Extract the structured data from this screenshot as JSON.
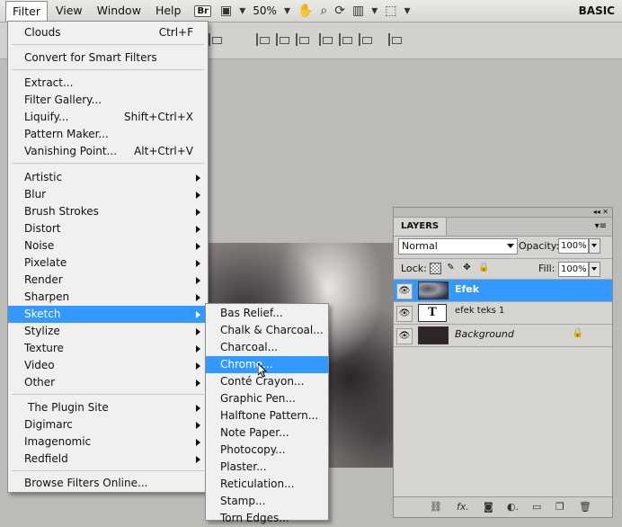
{
  "menubar": {
    "items": [
      "Filter",
      "View",
      "Window",
      "Help"
    ],
    "br_label": "Br",
    "zoom": "50%",
    "workspace": "BASIC"
  },
  "filter_menu": {
    "items": [
      {
        "label": "Clouds",
        "shortcut": "Ctrl+F"
      },
      {
        "label": "Convert for Smart Filters"
      },
      {
        "label": "Extract..."
      },
      {
        "label": "Filter Gallery..."
      },
      {
        "label": "Liquify...",
        "shortcut": "Shift+Ctrl+X"
      },
      {
        "label": "Pattern Maker..."
      },
      {
        "label": "Vanishing Point...",
        "shortcut": "Alt+Ctrl+V"
      },
      {
        "label": "Artistic"
      },
      {
        "label": "Blur"
      },
      {
        "label": "Brush Strokes"
      },
      {
        "label": "Distort"
      },
      {
        "label": "Noise"
      },
      {
        "label": "Pixelate"
      },
      {
        "label": "Render"
      },
      {
        "label": "Sharpen"
      },
      {
        "label": "Sketch"
      },
      {
        "label": "Stylize"
      },
      {
        "label": "Texture"
      },
      {
        "label": "Video"
      },
      {
        "label": "Other"
      },
      {
        "label": "The Plugin Site"
      },
      {
        "label": "Digimarc"
      },
      {
        "label": "Imagenomic"
      },
      {
        "label": "Redfield"
      },
      {
        "label": "Browse Filters Online..."
      }
    ]
  },
  "sketch_menu": {
    "items": [
      "Bas Relief...",
      "Chalk & Charcoal...",
      "Charcoal...",
      "Chrome...",
      "Conté Crayon...",
      "Graphic Pen...",
      "Halftone Pattern...",
      "Note Paper...",
      "Photocopy...",
      "Plaster...",
      "Reticulation...",
      "Stamp...",
      "Torn Edges..."
    ]
  },
  "layers_panel": {
    "tab": "LAYERS",
    "blend_mode": "Normal",
    "opacity_label": "Opacity:",
    "opacity": "100%",
    "lock_label": "Lock:",
    "fill_label": "Fill:",
    "fill": "100%",
    "layers": [
      {
        "name": "Efek"
      },
      {
        "name": "efek teks 1",
        "thumb_text": "T"
      },
      {
        "name": "Background"
      }
    ]
  },
  "colors": {
    "selection": "#3399ff",
    "menu_bg": "#f0f0f0",
    "workspace_bg": "#bdbbb7"
  }
}
